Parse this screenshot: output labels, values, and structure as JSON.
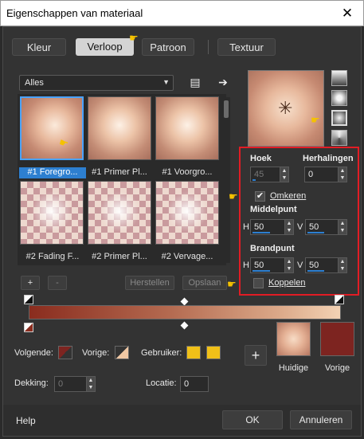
{
  "window": {
    "title": "Eigenschappen van materiaal",
    "close_glyph": "✕"
  },
  "tabs": [
    {
      "label": "Kleur",
      "selected": false
    },
    {
      "label": "Verloop",
      "selected": true
    },
    {
      "label": "Patroon",
      "selected": false
    },
    {
      "label": "Textuur",
      "selected": false
    }
  ],
  "category": {
    "value": "Alles"
  },
  "gradients": [
    {
      "label": "#1 Foregro..."
    },
    {
      "label": "#1 Primer Pl..."
    },
    {
      "label": "#1 Voorgro..."
    },
    {
      "label": "#2 Fading F..."
    },
    {
      "label": "#2 Primer Pl..."
    },
    {
      "label": "#2 Vervage..."
    }
  ],
  "buttons": {
    "add": "+",
    "remove": "-",
    "reset": "Herstellen",
    "save": "Opslaan",
    "ok": "OK",
    "cancel": "Annuleren",
    "help": "Help",
    "swap": "+"
  },
  "settings": {
    "angle_label": "Hoek",
    "angle": "45",
    "repeats_label": "Herhalingen",
    "repeats": "0",
    "invert_label": "Omkeren",
    "invert_checked": true,
    "center_label": "Middelpunt",
    "center_h": "50",
    "center_v": "50",
    "focal_label": "Brandpunt",
    "focal_h": "50",
    "focal_v": "50",
    "link_label": "Koppelen",
    "link_checked": false,
    "h": "H",
    "v": "V"
  },
  "editor": {
    "next_label": "Volgende:",
    "prev_label": "Vorige:",
    "user_label": "Gebruiker:",
    "opacity_label": "Dekking:",
    "opacity": "0",
    "location_label": "Locatie:",
    "location": "0"
  },
  "swatches": {
    "current_label": "Huidige",
    "previous_label": "Vorige",
    "previous_color": "#7d2420"
  },
  "colors": {
    "selection": "#2d7fd0",
    "highlight_border": "#e21c24",
    "user_swatch": "#f0c018"
  },
  "icons": [
    "close-icon",
    "dropdown-arrow-icon",
    "browse-icon",
    "arrow-right-icon",
    "pointer-hand-icon",
    "linear-style-icon",
    "rectangular-style-icon",
    "radial-style-icon",
    "sunburst-style-icon",
    "checkmark-icon"
  ]
}
